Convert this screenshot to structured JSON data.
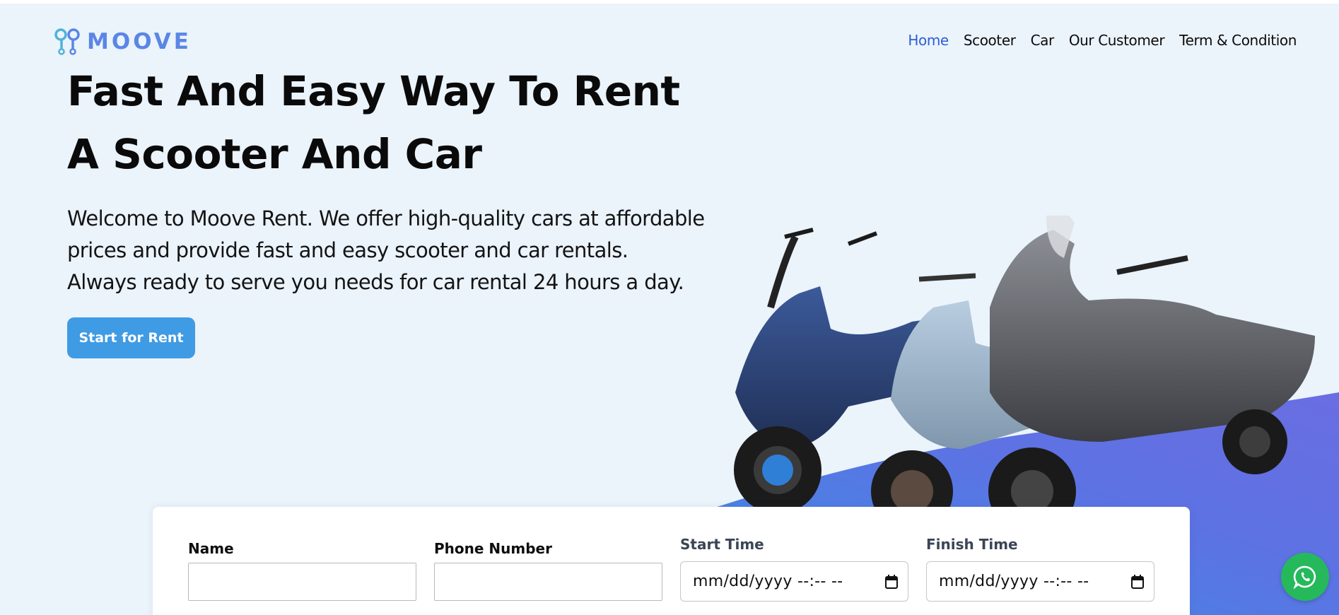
{
  "brand": {
    "name": "MOOVE",
    "accent": "#5a86e6"
  },
  "nav": {
    "items": [
      {
        "label": "Home",
        "active": true
      },
      {
        "label": "Scooter",
        "active": false
      },
      {
        "label": "Car",
        "active": false
      },
      {
        "label": "Our Customer",
        "active": false
      },
      {
        "label": "Term & Condition",
        "active": false
      }
    ],
    "active_color": "#2d5fd3"
  },
  "hero": {
    "headline_line1": "Fast And Easy Way To Rent",
    "headline_line2": "A Scooter And Car",
    "lead_line1": "Welcome to Moove Rent. We offer high-quality cars at affordable",
    "lead_line2": "prices and provide fast and easy scooter and car rentals.",
    "lead_line3": "Always ready to serve you needs for car rental 24 hours a day.",
    "cta_label": "Start for Rent",
    "cta_color": "#3f9be4",
    "background": "#ebf3fb"
  },
  "booking_form": {
    "name_label": "Name",
    "name_value": "",
    "phone_label": "Phone Number",
    "phone_value": "",
    "start_label": "Start Time",
    "start_placeholder": "mm/dd/yyyy --:-- --",
    "finish_label": "Finish Time",
    "finish_placeholder": "mm/dd/yyyy --:-- --"
  },
  "whatsapp": {
    "icon": "whatsapp-icon",
    "color": "#25b95c"
  }
}
